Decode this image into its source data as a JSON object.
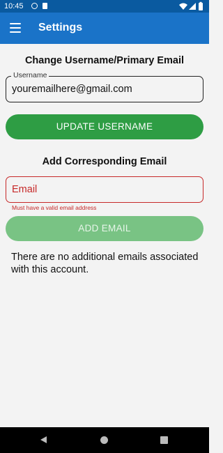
{
  "status_bar": {
    "time": "10:45",
    "icons": [
      "notification-icon",
      "sd-card-icon",
      "wifi-icon",
      "signal-icon",
      "battery-icon"
    ]
  },
  "app_bar": {
    "title": "Settings",
    "menu_icon": "hamburger-menu-icon"
  },
  "username_section": {
    "title": "Change Username/Primary Email",
    "field_label": "Username",
    "field_value": "youremailhere@gmail.com",
    "button_label": "UPDATE USERNAME"
  },
  "email_section": {
    "title": "Add Corresponding Email",
    "field_placeholder": "Email",
    "error_text": "Must have a valid email address",
    "button_label": "ADD EMAIL",
    "info_text": "There are no additional emails associated with this account."
  },
  "colors": {
    "status_bar": "#0a5aa0",
    "app_bar": "#1a73c8",
    "primary_button": "#2e9d44",
    "disabled_button": "#79c384",
    "error": "#c62828"
  },
  "nav_bar": {
    "icons": [
      "back-icon",
      "home-icon",
      "recents-icon"
    ]
  }
}
